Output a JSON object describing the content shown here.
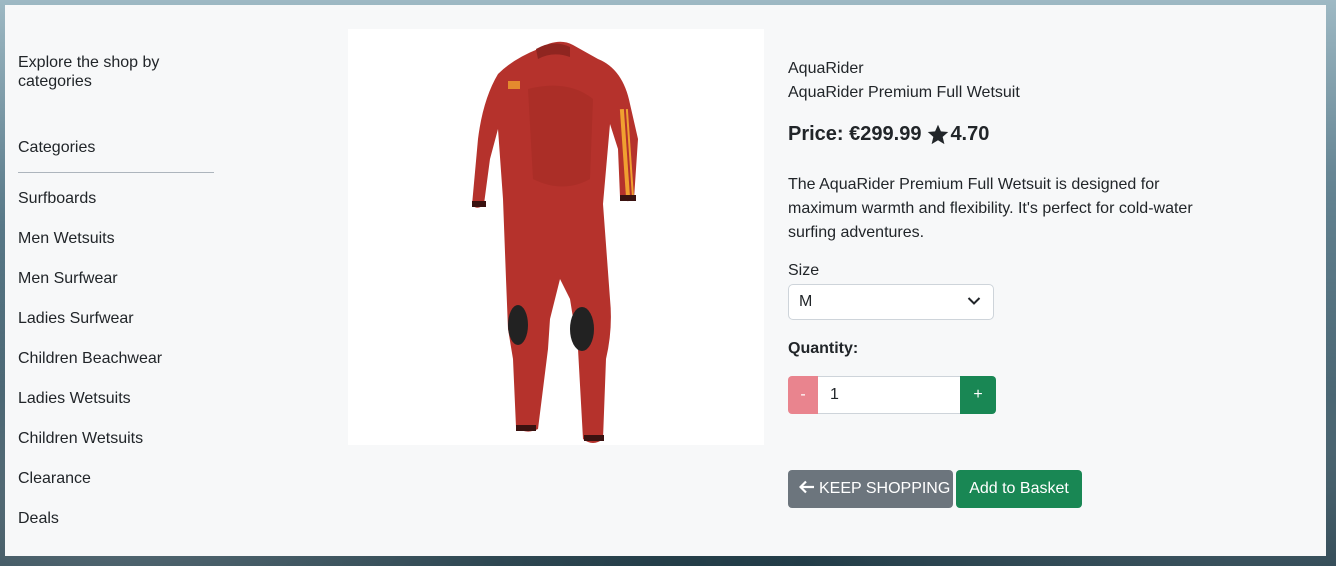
{
  "sidebar": {
    "intro": "Explore the shop by categories",
    "heading": "Categories",
    "categories": [
      "Surfboards",
      "Men Wetsuits",
      "Men Surfwear",
      "Ladies Surfwear",
      "Children Beachwear",
      "Ladies Wetsuits",
      "Children Wetsuits",
      "Clearance",
      "Deals"
    ]
  },
  "product": {
    "brand": "AquaRider",
    "name": "AquaRider Premium Full Wetsuit",
    "price_label": "Price: €299.99",
    "rating": "4.70",
    "description": "The AquaRider Premium Full Wetsuit is designed for maximum warmth and flexibility. It's perfect for cold-water surfing adventures.",
    "image_icon": "wetsuit-image",
    "colors": {
      "suit": "#b5322c",
      "accent": "#f0a030",
      "knee": "#222222"
    }
  },
  "size": {
    "label": "Size",
    "selected": "M"
  },
  "quantity": {
    "label": "Quantity:",
    "value": "1",
    "minus_label": "-",
    "plus_label": "+"
  },
  "actions": {
    "keep_shopping": "KEEP SHOPPING",
    "add_to_basket": "Add to Basket"
  },
  "colors": {
    "success": "#198754",
    "danger_light": "#e9848e",
    "secondary": "#6c757d",
    "panel": "#f7f8f9"
  }
}
